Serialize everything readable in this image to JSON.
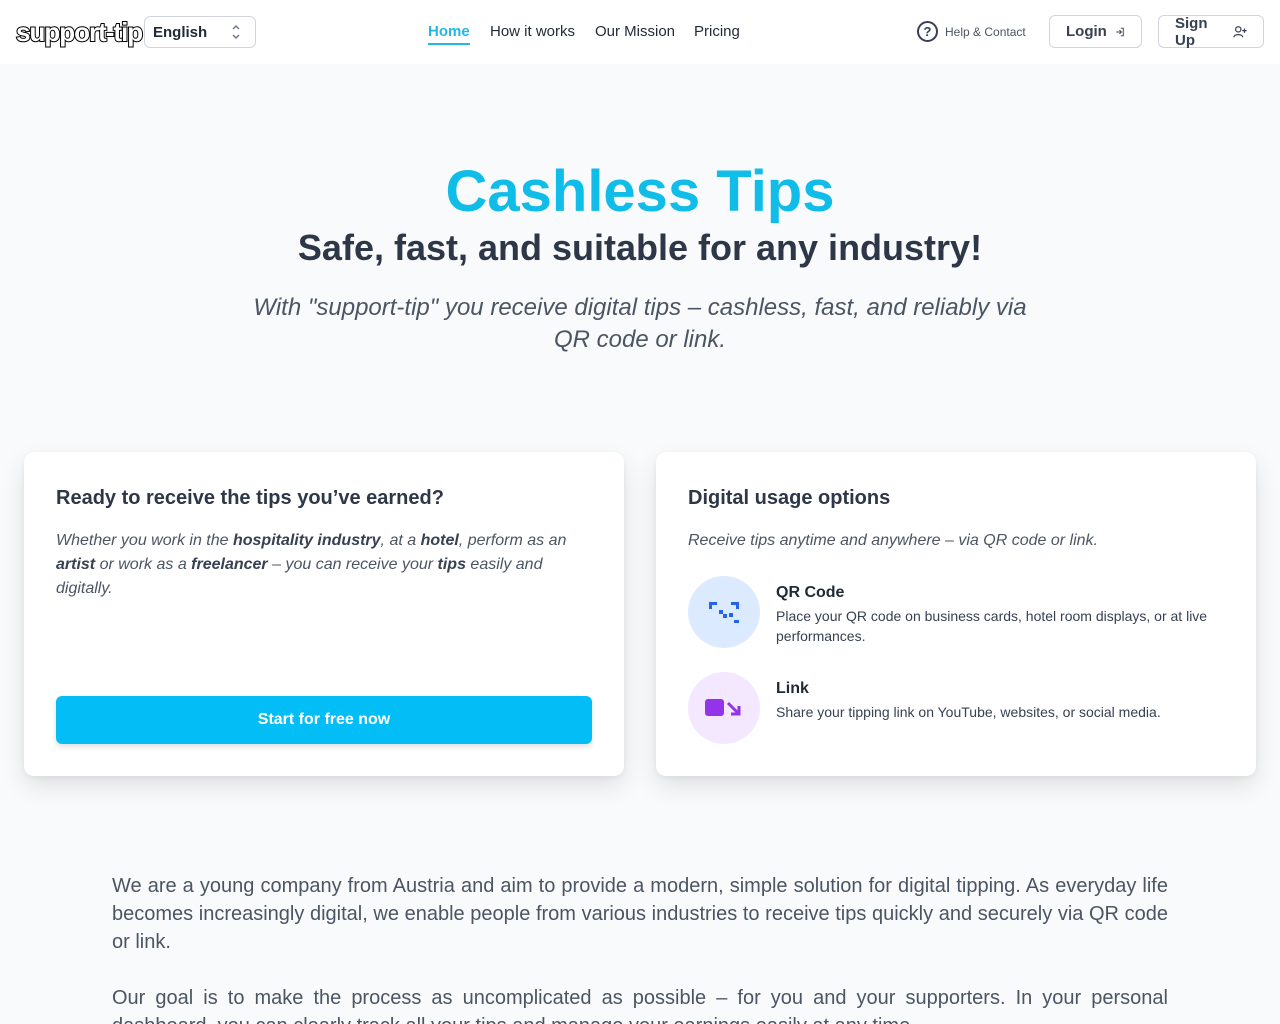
{
  "header": {
    "logo_text": "support-tip",
    "language": "English",
    "nav": [
      "Home",
      "How it works",
      "Our Mission",
      "Pricing"
    ],
    "active_nav": "Home",
    "help_label": "Help & Contact",
    "login_label": "Login",
    "signup_label": "Sign Up"
  },
  "hero": {
    "title": "Cashless Tips",
    "subtitle": "Safe, fast, and suitable for any industry!",
    "description": "With \"support-tip\" you receive digital tips – cashless, fast, and reliably via QR code or link."
  },
  "card_left": {
    "title": "Ready to receive the tips you’ve earned?",
    "intro_parts": [
      "Whether you work in the ",
      "hospitality industry",
      ", at a ",
      "hotel",
      ", perform as an ",
      "artist",
      " or work as a ",
      "freelancer",
      " – you can receive your ",
      "tips",
      " easily and digitally."
    ],
    "cta_label": "Start for free now"
  },
  "card_right": {
    "title": "Digital usage options",
    "intro": "Receive tips anytime and anywhere – via QR code or link.",
    "options": [
      {
        "title": "QR Code",
        "description": "Place your QR code on business cards, hotel room displays, or at live performances.",
        "icon": "qr-code-icon",
        "bg_color": "#dbeafe",
        "icon_color": "#2563eb"
      },
      {
        "title": "Link",
        "description": "Share your tipping link on YouTube, websites, or social media.",
        "icon": "video-link-icon",
        "bg_color": "#f3e8ff",
        "icon_color": "#9333ea"
      }
    ]
  },
  "about": {
    "paragraph1": "We are a young company from Austria and aim to provide a modern, simple solution for digital tipping. As everyday life becomes increasingly digital, we enable people from various industries to receive tips quickly and securely via QR code or link.",
    "paragraph2": "Our goal is to make the process as uncomplicated as possible – for you and your supporters. In your personal dashboard, you can clearly track all your tips and manage your earnings easily at any time."
  },
  "colors": {
    "accent": "#10bde9",
    "cta": "#03bdf7"
  }
}
